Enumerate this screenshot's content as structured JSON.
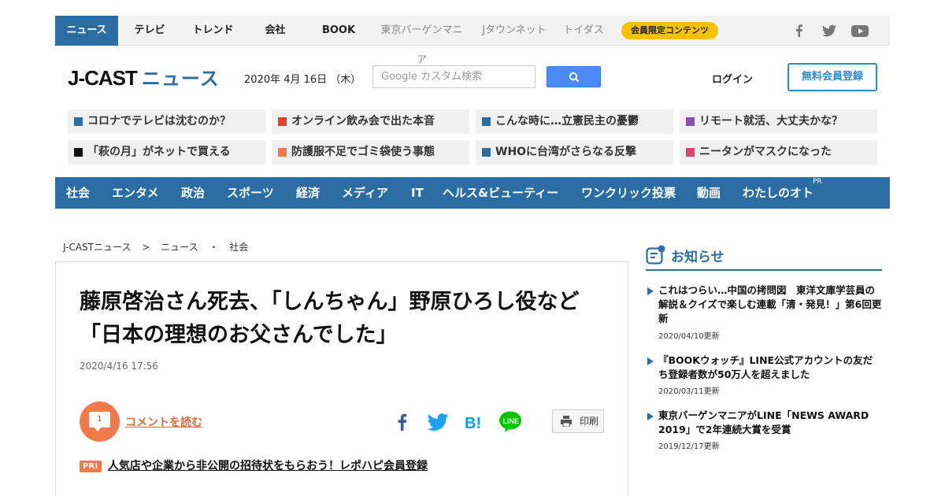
{
  "topnav": {
    "items": [
      "ニュース",
      "テレビ",
      "トレンド",
      "会社",
      "BOOK",
      "東京バーゲンマニア",
      "Jタウンネット",
      "トイダス"
    ],
    "member_badge": "会員限定コンテンツ",
    "social_icons": [
      "facebook-icon",
      "twitter-icon",
      "youtube-icon"
    ]
  },
  "header": {
    "logo_main": "J-CAST",
    "logo_sub": "ニュース",
    "date": "2020年 4月 16日 （木）",
    "search_placeholder": "Google カスタム検索",
    "login": "ログイン",
    "register": "無料会員登録"
  },
  "topics": [
    {
      "label": "コロナでテレビは沈むのか？",
      "color": "#2b6da3"
    },
    {
      "label": "オンライン飲み会で出た本音",
      "color": "#e0452b"
    },
    {
      "label": "こんな時に…立憲民主の憂鬱",
      "color": "#2b6da3"
    },
    {
      "label": "リモート就活、大丈夫かな？",
      "color": "#8e4bb0"
    },
    {
      "label": "「萩の月」がネットで買える",
      "color": "#111111"
    },
    {
      "label": "防護服不足でゴミ袋使う事態",
      "color": "#ef7a4b"
    },
    {
      "label": "WHOに台湾がさらなる反撃",
      "color": "#2b6da3"
    },
    {
      "label": "ニータンがマスクになった",
      "color": "#e83e6c"
    }
  ],
  "categories": [
    "社会",
    "エンタメ",
    "政治",
    "スポーツ",
    "経済",
    "メディア",
    "IT",
    "ヘルス&ビューティー",
    "ワンクリック投票",
    "動画",
    "わたしのオト"
  ],
  "categories_pr": "PR",
  "breadcrumb": [
    "J-CASTニュース",
    ">",
    "ニュース",
    "・",
    "社会"
  ],
  "article": {
    "title": "藤原啓治さん死去、「しんちゃん」野原ひろし役など 「日本の理想のお父さんでした」",
    "date": "2020/4/16 17:56",
    "comment_count": "1",
    "comment_link": "コメントを読む",
    "print": "印刷",
    "pr_badge": "PR!",
    "pr_link": "人気店や企業から非公開の招待状をもらおう！レポハピ会員登録"
  },
  "sidebar": {
    "heading": "お知らせ",
    "news": [
      {
        "title": "これはつらい…中国の拷問図　東洋文庫学芸員の解説＆クイズで楽しむ連載「清・発見！」第6回更新",
        "date": "2020/04/10更新"
      },
      {
        "title": "『BOOKウォッチ』LINE公式アカウントの友だち登録者数が50万人を超えました",
        "date": "2020/03/11更新"
      },
      {
        "title": "東京バーゲンマニアがLINE「NEWS AWARD 2019」で2年連続大賞を受賞",
        "date": "2019/12/17更新"
      }
    ]
  },
  "colors": {
    "primary": "#2b6da3",
    "accent": "#ef7a4b",
    "badge": "#f5c200"
  }
}
